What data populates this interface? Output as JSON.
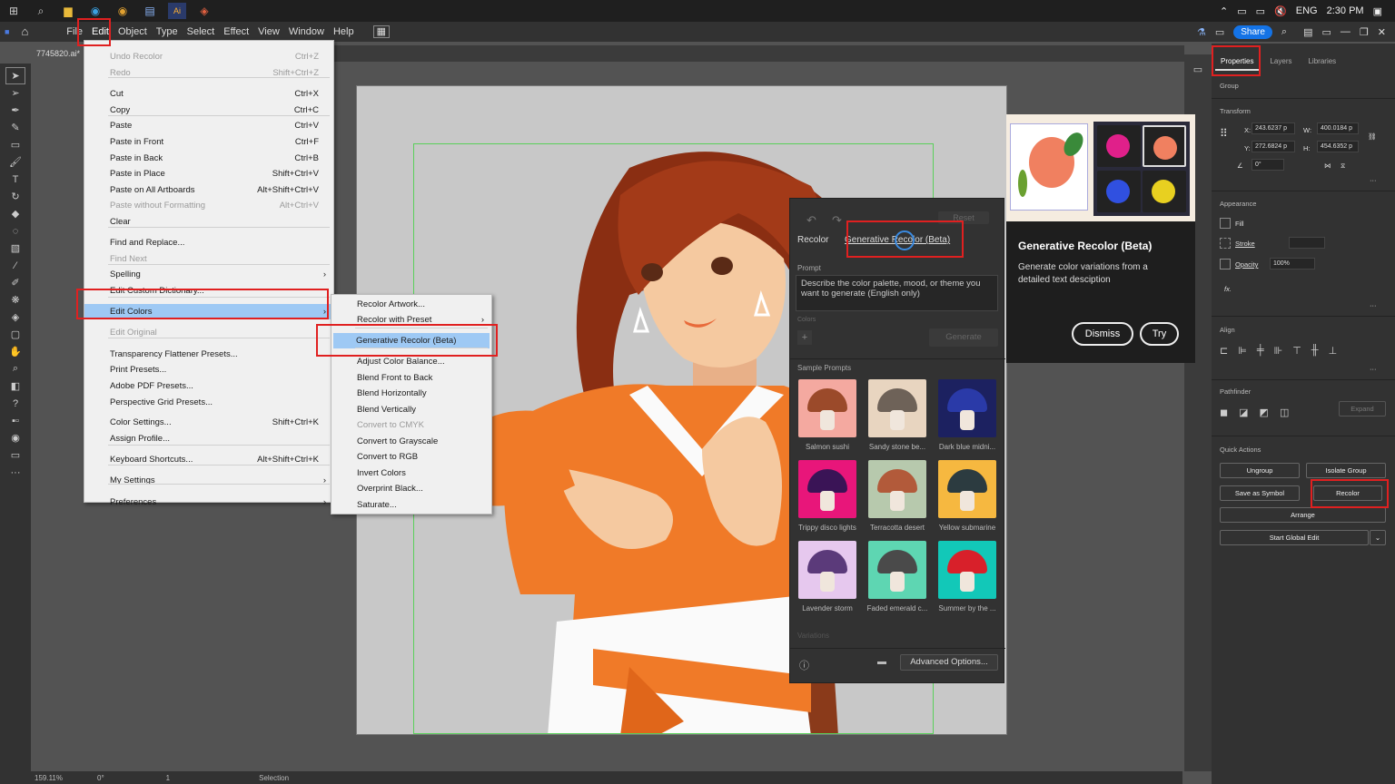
{
  "taskbar": {
    "language": "ENG",
    "time": "2:30 PM"
  },
  "menubar": {
    "items": [
      "File",
      "Edit",
      "Object",
      "Type",
      "Select",
      "Effect",
      "View",
      "Window",
      "Help"
    ],
    "share": "Share"
  },
  "document": {
    "tab": "7745820.ai*"
  },
  "edit_menu": [
    {
      "label": "Undo Recolor",
      "shortcut": "Ctrl+Z",
      "disabled": true
    },
    {
      "label": "Redo",
      "shortcut": "Shift+Ctrl+Z",
      "disabled": true
    },
    {
      "label": "Cut",
      "shortcut": "Ctrl+X"
    },
    {
      "label": "Copy",
      "shortcut": "Ctrl+C"
    },
    {
      "label": "Paste",
      "shortcut": "Ctrl+V"
    },
    {
      "label": "Paste in Front",
      "shortcut": "Ctrl+F"
    },
    {
      "label": "Paste in Back",
      "shortcut": "Ctrl+B"
    },
    {
      "label": "Paste in Place",
      "shortcut": "Shift+Ctrl+V"
    },
    {
      "label": "Paste on All Artboards",
      "shortcut": "Alt+Shift+Ctrl+V"
    },
    {
      "label": "Paste without Formatting",
      "shortcut": "Alt+Ctrl+V",
      "disabled": true
    },
    {
      "label": "Clear",
      "shortcut": ""
    },
    {
      "label": "Find and Replace...",
      "shortcut": ""
    },
    {
      "label": "Find Next",
      "shortcut": "",
      "disabled": true
    },
    {
      "label": "Spelling",
      "shortcut": "",
      "submenu": true
    },
    {
      "label": "Edit Custom Dictionary...",
      "shortcut": ""
    },
    {
      "label": "Edit Colors",
      "shortcut": "",
      "submenu": true,
      "highlight": true
    },
    {
      "label": "Edit Original",
      "shortcut": "",
      "disabled": true
    },
    {
      "label": "Transparency Flattener Presets...",
      "shortcut": ""
    },
    {
      "label": "Print Presets...",
      "shortcut": ""
    },
    {
      "label": "Adobe PDF Presets...",
      "shortcut": ""
    },
    {
      "label": "Perspective Grid Presets...",
      "shortcut": ""
    },
    {
      "label": "Color Settings...",
      "shortcut": "Shift+Ctrl+K"
    },
    {
      "label": "Assign Profile...",
      "shortcut": ""
    },
    {
      "label": "Keyboard Shortcuts...",
      "shortcut": "Alt+Shift+Ctrl+K"
    },
    {
      "label": "My Settings",
      "shortcut": "",
      "submenu": true
    },
    {
      "label": "Preferences",
      "shortcut": "",
      "submenu": true
    }
  ],
  "colors_submenu": [
    {
      "label": "Recolor Artwork..."
    },
    {
      "label": "Recolor with Preset",
      "submenu": true
    },
    {
      "label": "Generative Recolor (Beta)",
      "highlight": true
    },
    {
      "label": "Adjust Color Balance..."
    },
    {
      "label": "Blend Front to Back"
    },
    {
      "label": "Blend Horizontally"
    },
    {
      "label": "Blend Vertically"
    },
    {
      "label": "Convert to CMYK",
      "disabled": true
    },
    {
      "label": "Convert to Grayscale"
    },
    {
      "label": "Convert to RGB"
    },
    {
      "label": "Invert Colors"
    },
    {
      "label": "Overprint Black..."
    },
    {
      "label": "Saturate..."
    }
  ],
  "recolor_panel": {
    "reset": "Reset",
    "tab_recolor": "Recolor",
    "tab_generative": "Generative Recolor (Beta)",
    "prompt_label": "Prompt",
    "prompt_placeholder": "Describe the color palette, mood, or theme you want to generate (English only)",
    "colors_label": "Colors",
    "generate": "Generate",
    "sample_prompts": "Sample Prompts",
    "samples": [
      {
        "label": "Salmon sushi",
        "bg": "#f4a9a0",
        "cap": "#9b4a2a"
      },
      {
        "label": "Sandy stone be...",
        "bg": "#e8d5c0",
        "cap": "#6e6258"
      },
      {
        "label": "Dark blue midni...",
        "bg": "#1c2160",
        "cap": "#2a3aa8"
      },
      {
        "label": "Trippy disco lights",
        "bg": "#e8167a",
        "cap": "#3a1456"
      },
      {
        "label": "Terracotta desert",
        "bg": "#b7c9ad",
        "cap": "#b25a3a"
      },
      {
        "label": "Yellow submarine",
        "bg": "#f6b840",
        "cap": "#2c3b40"
      },
      {
        "label": "Lavender storm",
        "bg": "#e6c8ee",
        "cap": "#5b3a7a"
      },
      {
        "label": "Faded emerald c...",
        "bg": "#5ed6b2",
        "cap": "#4a4a4a"
      },
      {
        "label": "Summer by the ...",
        "bg": "#12c8b8",
        "cap": "#d8202a"
      }
    ],
    "variations": "Variations",
    "advanced": "Advanced Options..."
  },
  "coachmark": {
    "title": "Generative Recolor (Beta)",
    "desc": "Generate color variations from a detailed text desciption",
    "dismiss": "Dismiss",
    "try": "Try"
  },
  "properties": {
    "tabs": [
      "Properties",
      "Layers",
      "Libraries"
    ],
    "group": "Group",
    "transform": "Transform",
    "x": "243.6237 p",
    "y": "272.6824 p",
    "w": "400.0184 p",
    "h": "454.6352 p",
    "x_lbl": "X:",
    "y_lbl": "Y:",
    "w_lbl": "W:",
    "h_lbl": "H:",
    "angle": "0°",
    "appearance": "Appearance",
    "fill": "Fill",
    "stroke": "Stroke",
    "opacity": "Opacity",
    "opacity_val": "100%",
    "fx": "fx.",
    "align": "Align",
    "pathfinder": "Pathfinder",
    "expand": "Expand",
    "quick_actions": "Quick Actions",
    "ungroup": "Ungroup",
    "isolate": "Isolate Group",
    "save_symbol": "Save as Symbol",
    "recolor": "Recolor",
    "arrange": "Arrange",
    "global_edit": "Start Global Edit"
  },
  "status": {
    "zoom": "159.11%",
    "angle": "0°",
    "artboard": "1",
    "tool": "Selection"
  }
}
